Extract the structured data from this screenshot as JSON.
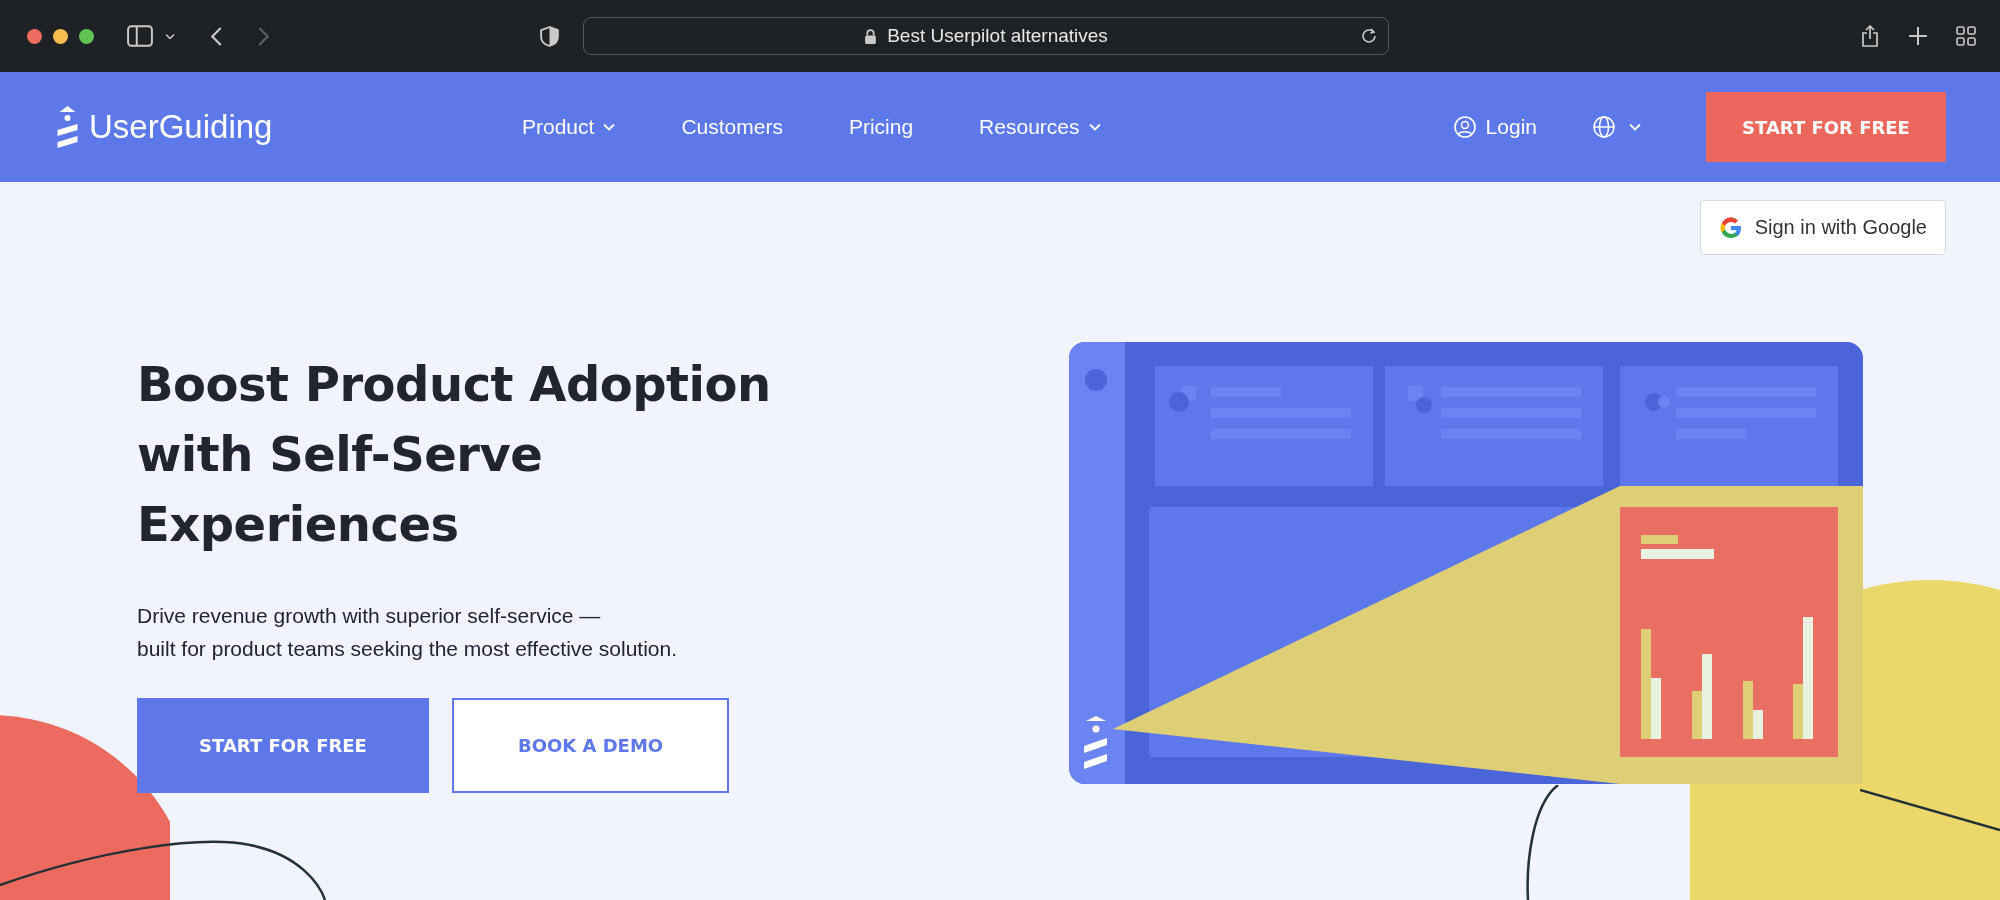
{
  "browser": {
    "address": "Best Userpilot alternatives"
  },
  "nav": {
    "logo": "UserGuiding",
    "items": [
      {
        "label": "Product",
        "has_dropdown": true
      },
      {
        "label": "Customers",
        "has_dropdown": false
      },
      {
        "label": "Pricing",
        "has_dropdown": false
      },
      {
        "label": "Resources",
        "has_dropdown": true
      }
    ],
    "login": "Login",
    "cta": "START FOR FREE"
  },
  "google_signin": "Sign in with Google",
  "hero": {
    "title_lines": [
      "Boost Product Adoption",
      "with Self-Serve",
      "Experiences"
    ],
    "subtitle_lines": [
      "Drive revenue growth with superior self-service —",
      "built for product teams seeking the most effective solution."
    ],
    "buttons": [
      {
        "label": "START FOR FREE",
        "kind": "primary"
      },
      {
        "label": "BOOK A DEMO",
        "kind": "outline"
      }
    ]
  }
}
